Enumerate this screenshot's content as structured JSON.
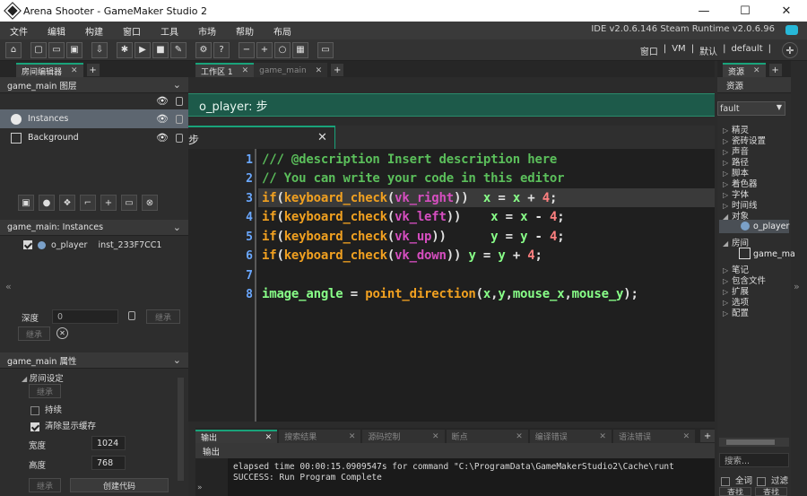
{
  "window": {
    "title": "Arena Shooter - GameMaker Studio 2",
    "buttons": [
      "—",
      "☐",
      "✕"
    ]
  },
  "menu": {
    "items": [
      "文件",
      "编辑",
      "构建",
      "窗口",
      "工具",
      "市场",
      "帮助",
      "布局"
    ],
    "ide_version": "IDE v2.0.6.146 Steam Runtime v2.0.6.96"
  },
  "toolbar": {
    "right_text": [
      "窗口",
      "|",
      "VM",
      "|",
      "默认",
      "|",
      "default",
      "|"
    ]
  },
  "left_panel": {
    "tab_label": "房间编辑器",
    "layers_header": "game_main 图层",
    "layers": [
      {
        "label": "Instances",
        "selected": true
      },
      {
        "label": "Background",
        "selected": false
      }
    ],
    "instances_header": "game_main: Instances",
    "instance": {
      "object": "o_player",
      "id": "inst_233F7CC1"
    },
    "depth_label": "深度",
    "depth_value": "0",
    "inherit_label": "继承",
    "properties_header": "game_main 属性",
    "room_settings_label": "房间设定",
    "persistent_label": "持续",
    "clear_buffer_label": "清除显示缓存",
    "width_label": "宽度",
    "width_value": "1024",
    "height_label": "高度",
    "height_value": "768",
    "create_code_label": "创建代码"
  },
  "workspace": {
    "tabs": [
      {
        "label": "工作区 1",
        "active": true
      },
      {
        "label": "game_main",
        "active": false
      }
    ],
    "object_header": "o_player: 步",
    "event_tab": "步"
  },
  "code": {
    "line_numbers": [
      "1",
      "2",
      "3",
      "4",
      "5",
      "6",
      "7",
      "8"
    ],
    "lines": [
      "/// @description Insert description here",
      "// You can write your code in this editor",
      "if(keyboard_check(vk_right))  x = x + 4;",
      "if(keyboard_check(vk_left))    x = x - 4;",
      "if(keyboard_check(vk_up))      y = y - 4;",
      "if(keyboard_check(vk_down)) y = y + 4;",
      "",
      "image_angle = point_direction(x,y,mouse_x,mouse_y);"
    ]
  },
  "output": {
    "tabs": [
      "输出",
      "搜索结果",
      "源码控制",
      "断点",
      "编译错误",
      "语法错误"
    ],
    "header": "输出",
    "lines": [
      "elapsed time 00:00:15.0909547s for command \"C:\\ProgramData\\GameMakerStudio2\\Cache\\runt",
      "SUCCESS: Run Program Complete"
    ]
  },
  "right_panel": {
    "tab_label": "资源",
    "header": "资源",
    "dropdown_value": "fault",
    "tree": [
      {
        "label": "精灵",
        "expanded": false
      },
      {
        "label": "瓷砖设置",
        "expanded": false
      },
      {
        "label": "声音",
        "expanded": false
      },
      {
        "label": "路径",
        "expanded": false
      },
      {
        "label": "脚本",
        "expanded": false
      },
      {
        "label": "着色器",
        "expanded": false
      },
      {
        "label": "字体",
        "expanded": false
      },
      {
        "label": "时间线",
        "expanded": false
      },
      {
        "label": "对象",
        "expanded": true
      },
      {
        "label": "o_player",
        "child": true
      },
      {
        "label": "房间",
        "expanded": true
      },
      {
        "label": "game_ma",
        "child": true
      },
      {
        "label": "笔记",
        "expanded": false
      },
      {
        "label": "包含文件",
        "expanded": false
      },
      {
        "label": "扩展",
        "expanded": false
      },
      {
        "label": "选项",
        "expanded": false
      },
      {
        "label": "配置",
        "expanded": false
      }
    ],
    "search_placeholder": "搜索...",
    "whole_word_label": "全词",
    "filter_label": "过滤",
    "find_label": "查找"
  }
}
